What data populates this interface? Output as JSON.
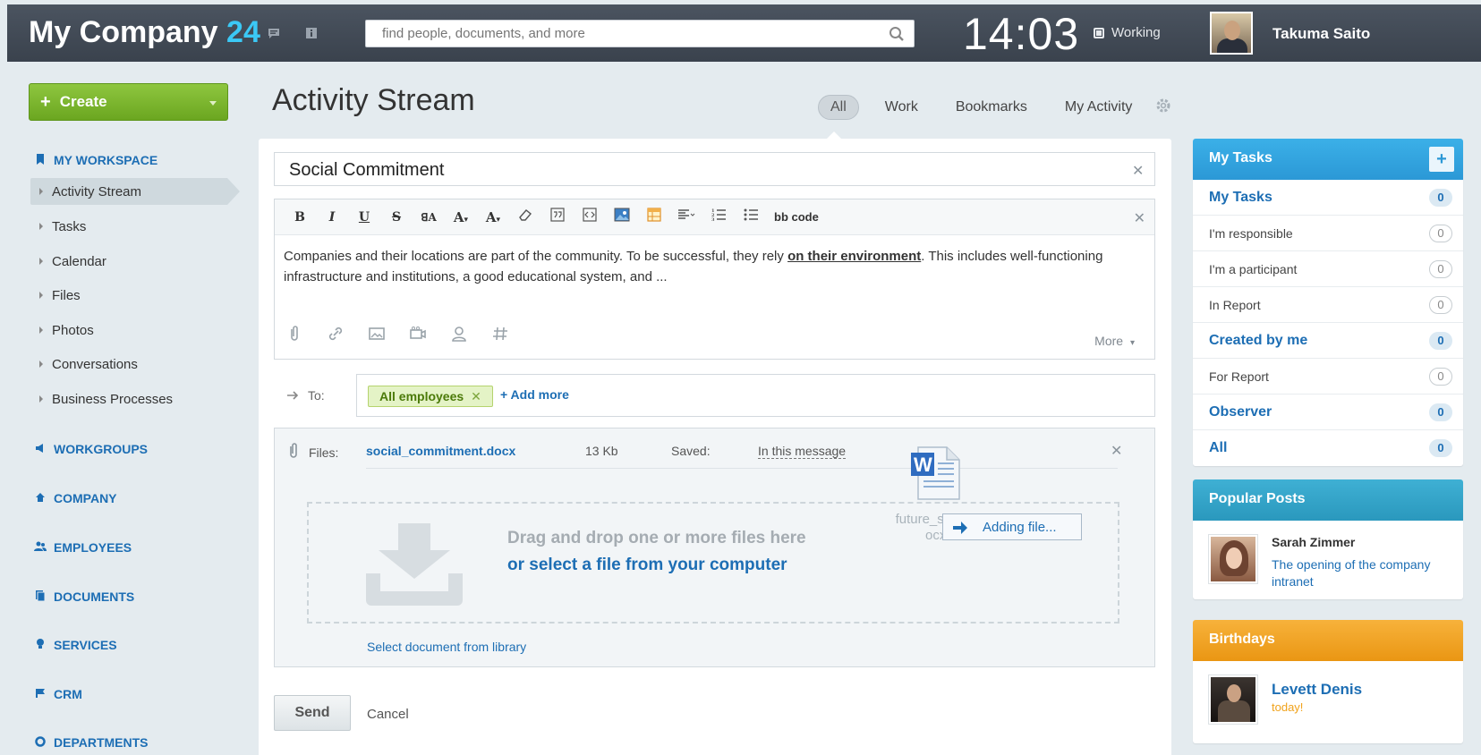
{
  "header": {
    "brand_name": "My Company",
    "brand_number": "24",
    "search_placeholder": "find people, documents, and more",
    "clock": "14:03",
    "work_status": "Working",
    "user_name": "Takuma Saito"
  },
  "sidebar": {
    "create_label": "Create",
    "my_workspace": "MY WORKSPACE",
    "items": [
      {
        "label": "Activity Stream",
        "active": true
      },
      {
        "label": "Tasks"
      },
      {
        "label": "Calendar"
      },
      {
        "label": "Files"
      },
      {
        "label": "Photos"
      },
      {
        "label": "Conversations"
      },
      {
        "label": "Business Processes"
      }
    ],
    "sections": [
      {
        "label": "WORKGROUPS",
        "icon": "megaphone-icon"
      },
      {
        "label": "COMPANY",
        "icon": "home-icon"
      },
      {
        "label": "EMPLOYEES",
        "icon": "people-icon"
      },
      {
        "label": "DOCUMENTS",
        "icon": "documents-icon"
      },
      {
        "label": "SERVICES",
        "icon": "lightbulb-icon"
      },
      {
        "label": "CRM",
        "icon": "flag-icon"
      },
      {
        "label": "DEPARTMENTS",
        "icon": "circle-icon"
      }
    ]
  },
  "main": {
    "title": "Activity Stream",
    "tabs": [
      {
        "label": "All",
        "active": true
      },
      {
        "label": "Work"
      },
      {
        "label": "Bookmarks"
      },
      {
        "label": "My Activity"
      }
    ],
    "post_title": "Social Commitment",
    "toolbar_bbcode": "bb code",
    "body_before": "Companies and their locations are part of the community. To be successful, they rely ",
    "body_link": "on their environment",
    "body_after": ". This includes well-functioning infrastructure and institutions, a good educational system, and ...",
    "more_label": "More",
    "to_label": "To:",
    "recipient_tag": "All employees",
    "add_more": "+ Add more",
    "files": {
      "label": "Files:",
      "name": "social_commitment.docx",
      "size": "13 Kb",
      "saved_label": "Saved:",
      "saved_where": "In this message",
      "drop_line1": "Drag and drop one or more files here",
      "drop_line2": "or select a file from your computer",
      "select_library": "Select document from library",
      "ghost_filename_line1": "future_s",
      "ghost_filename_line2": "ocx",
      "adding_label": "Adding file..."
    },
    "send_label": "Send",
    "cancel_label": "Cancel"
  },
  "widgets": {
    "tasks": {
      "title": "My Tasks",
      "rows": [
        {
          "label": "My Tasks",
          "count": "0",
          "bold": true
        },
        {
          "label": "I'm responsible",
          "count": "0"
        },
        {
          "label": "I'm a participant",
          "count": "0"
        },
        {
          "label": "In Report",
          "count": "0"
        },
        {
          "label": "Created by me",
          "count": "0",
          "bold": true
        },
        {
          "label": "For Report",
          "count": "0"
        },
        {
          "label": "Observer",
          "count": "0",
          "bold": true
        },
        {
          "label": "All",
          "count": "0",
          "bold": true
        }
      ]
    },
    "popular": {
      "title": "Popular Posts",
      "author": "Sarah Zimmer",
      "post_title": "The opening of the company intranet"
    },
    "birthdays": {
      "title": "Birthdays",
      "name": "Levett Denis",
      "when": "today!"
    }
  },
  "colors": {
    "topbar": "#3f4751",
    "accent_blue": "#1d6eb4",
    "brand_cyan": "#3bc8f5",
    "create_green": "#7ab62e",
    "birthday_orange": "#f0a21b"
  }
}
